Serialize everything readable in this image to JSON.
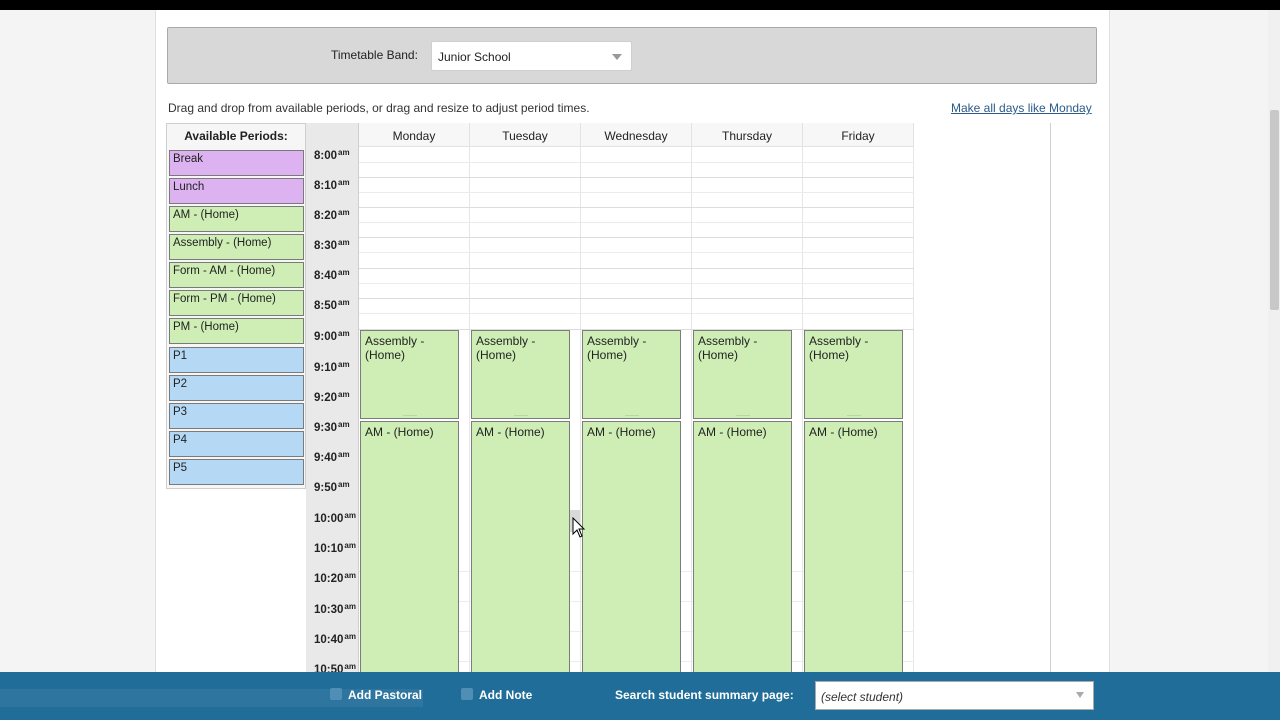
{
  "band": {
    "label": "Timetable Band:",
    "value": "Junior School"
  },
  "instructions": "Drag and drop from available periods, or drag and resize to adjust period times.",
  "make_all_link": "Make all days like Monday",
  "available": {
    "title": "Available Periods:",
    "periods": [
      {
        "label": "Break",
        "color": "#dcb3f0"
      },
      {
        "label": "Lunch",
        "color": "#dcb3f0"
      },
      {
        "label": "AM - (Home)",
        "color": "#cfeeb5"
      },
      {
        "label": "Assembly - (Home)",
        "color": "#cfeeb5"
      },
      {
        "label": "Form - AM - (Home)",
        "color": "#cfeeb5"
      },
      {
        "label": "Form - PM - (Home)",
        "color": "#cfeeb5"
      },
      {
        "label": "PM - (Home)",
        "color": "#cfeeb5"
      },
      {
        "label": "P1",
        "color": "#b5d9f5"
      },
      {
        "label": "P2",
        "color": "#b5d9f5"
      },
      {
        "label": "P3",
        "color": "#b5d9f5"
      },
      {
        "label": "P4",
        "color": "#b5d9f5"
      },
      {
        "label": "P5",
        "color": "#b5d9f5"
      }
    ]
  },
  "days": [
    "Monday",
    "Tuesday",
    "Wednesday",
    "Thursday",
    "Friday"
  ],
  "times": [
    "8:00",
    "8:10",
    "8:20",
    "8:30",
    "8:40",
    "8:50",
    "9:00",
    "9:10",
    "9:20",
    "9:30",
    "9:40",
    "9:50",
    "10:00",
    "10:10",
    "10:20",
    "10:30",
    "10:40",
    "10:50"
  ],
  "time_suffix": "am",
  "events": {
    "assembly": "Assembly - (Home)",
    "am_home": "AM - (Home)"
  },
  "bottom": {
    "add_pastoral": "Add Pastoral",
    "add_note": "Add Note",
    "search_label": "Search student summary page:",
    "student_placeholder": "(select student)"
  }
}
